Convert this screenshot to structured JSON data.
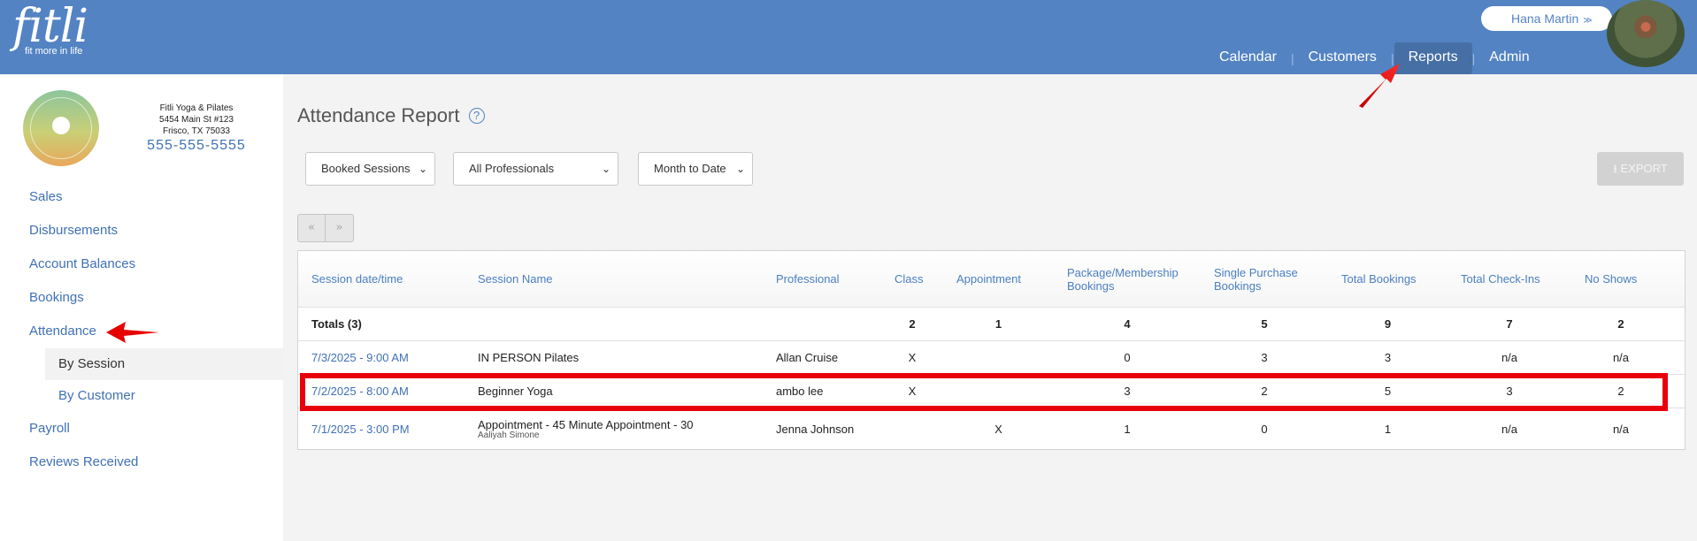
{
  "brand": {
    "name": "fitli",
    "tagline": "fit more in life"
  },
  "nav": {
    "items": [
      "Calendar",
      "Customers",
      "Reports",
      "Admin"
    ],
    "active": "Reports"
  },
  "user": {
    "name": "Hana Martin"
  },
  "business": {
    "name": "Fitli Yoga & Pilates",
    "address1": "5454 Main St #123",
    "address2": "Frisco, TX 75033",
    "phone": "555-555-5555"
  },
  "sidebar": {
    "items": [
      "Sales",
      "Disbursements",
      "Account Balances",
      "Bookings",
      "Attendance"
    ],
    "attendance_sub": [
      "By Session",
      "By Customer"
    ],
    "items_after": [
      "Payroll",
      "Reviews Received"
    ]
  },
  "report": {
    "title": "Attendance Report",
    "filters": {
      "type": "Booked Sessions",
      "professional": "All Professionals",
      "range": "Month to Date"
    },
    "export_label": "EXPORT",
    "pager": {
      "prev": "«",
      "next": "»"
    },
    "columns": [
      "Session date/time",
      "Session Name",
      "Professional",
      "Class",
      "Appointment",
      "Package/Membership Bookings",
      "Single Purchase Bookings",
      "Total Bookings",
      "Total Check-Ins",
      "No Shows"
    ],
    "totals": {
      "label": "Totals (3)",
      "class": "2",
      "appointment": "1",
      "package": "4",
      "single": "5",
      "total": "9",
      "checkins": "7",
      "noshows": "2"
    },
    "rows": [
      {
        "datetime": "7/3/2025 - 9:00 AM",
        "name": "IN PERSON Pilates",
        "sub": "",
        "professional": "Allan Cruise",
        "class": "X",
        "appointment": "",
        "package": "0",
        "single": "3",
        "total": "3",
        "checkins": "n/a",
        "noshows": "n/a"
      },
      {
        "datetime": "7/2/2025 - 8:00 AM",
        "name": "Beginner Yoga",
        "sub": "",
        "professional": "ambo lee",
        "class": "X",
        "appointment": "",
        "package": "3",
        "single": "2",
        "total": "5",
        "checkins": "3",
        "noshows": "2"
      },
      {
        "datetime": "7/1/2025 - 3:00 PM",
        "name": "Appointment - 45 Minute Appointment - 30",
        "sub": "Aaliyah Simone",
        "professional": "Jenna Johnson",
        "class": "",
        "appointment": "X",
        "package": "1",
        "single": "0",
        "total": "1",
        "checkins": "n/a",
        "noshows": "n/a"
      }
    ]
  },
  "colors": {
    "topbar": "#5383c3",
    "link": "#3f71b5",
    "highlight": "#e8000b"
  }
}
